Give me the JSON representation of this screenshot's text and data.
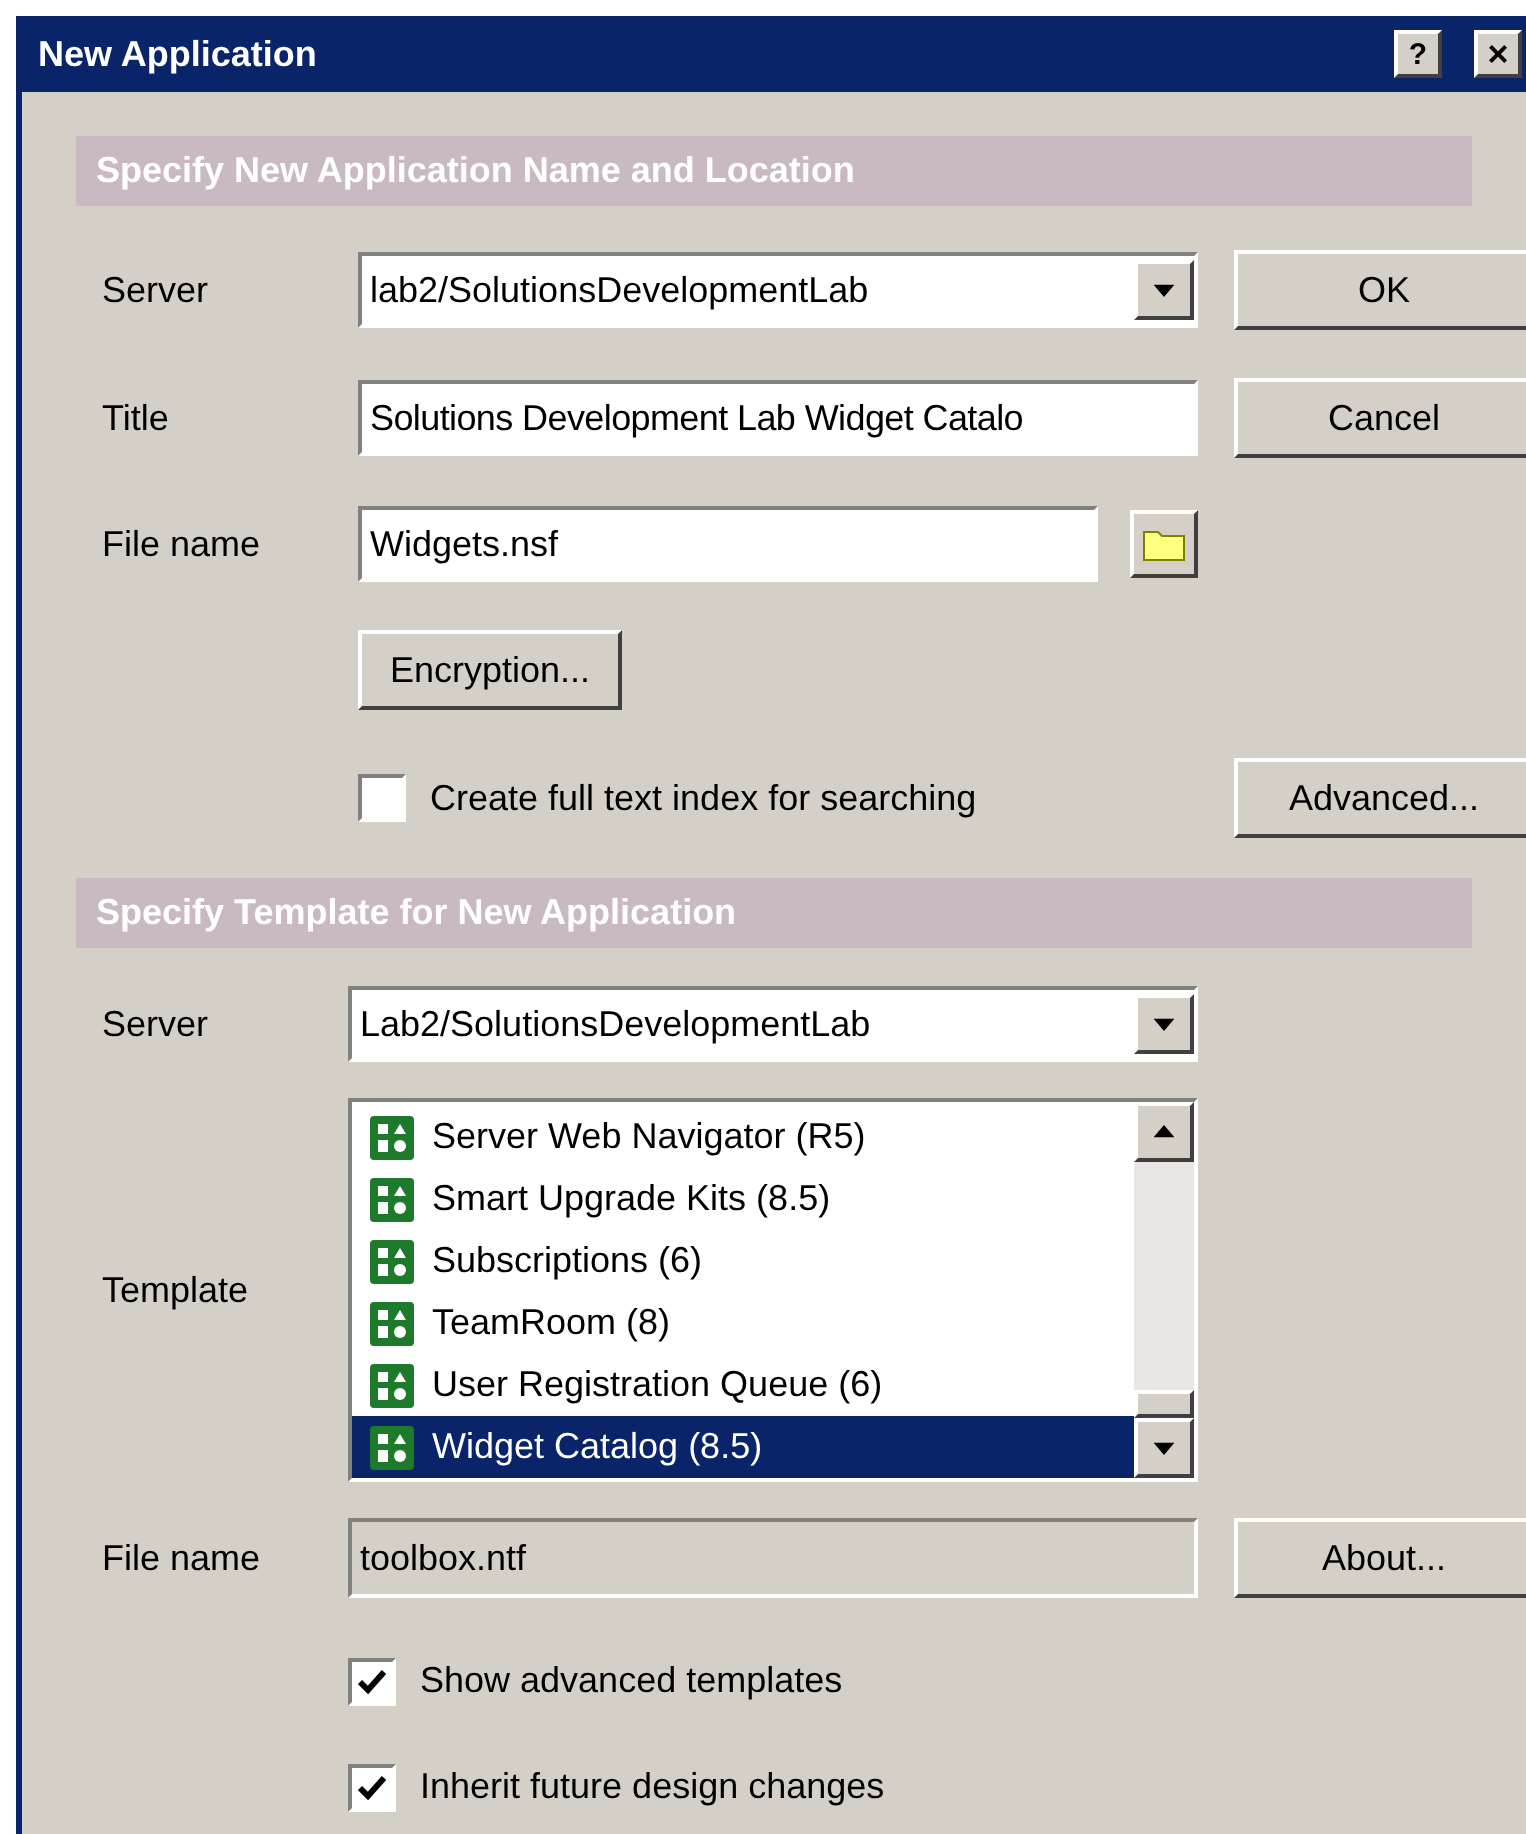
{
  "window": {
    "title": "New Application",
    "buttons": [
      "?",
      "×"
    ]
  },
  "section_1": {
    "header": "Specify New Application Name and Location",
    "server": {
      "label": "Server",
      "value": "lab2/SolutionsDevelopmentLab"
    },
    "title": {
      "label": "Title",
      "value": "Solutions Development Lab Widget Catalo"
    },
    "file_name": {
      "label": "File name",
      "value": "Widgets.nsf"
    },
    "encryption_button": "Encryption...",
    "full_text_index": {
      "label": "Create full text index for searching",
      "checked": false
    },
    "buttons": {
      "ok": "OK",
      "cancel": "Cancel",
      "advanced": "Advanced..."
    }
  },
  "section_2": {
    "header": "Specify Template for New Application",
    "server": {
      "label": "Server",
      "value": "Lab2/SolutionsDevelopmentLab"
    },
    "template_label": "Template",
    "templates": [
      {
        "label": "Server Web Navigator (R5)",
        "selected": false
      },
      {
        "label": "Smart Upgrade Kits (8.5)",
        "selected": false
      },
      {
        "label": "Subscriptions (6)",
        "selected": false
      },
      {
        "label": "TeamRoom (8)",
        "selected": false
      },
      {
        "label": "User Registration Queue (6)",
        "selected": false
      },
      {
        "label": "Widget Catalog (8.5)",
        "selected": true
      }
    ],
    "file_name": {
      "label": "File name",
      "value": "toolbox.ntf",
      "disabled": true
    },
    "about_button": "About...",
    "options": [
      {
        "label": "Show advanced templates",
        "checked": true
      },
      {
        "label": "Inherit future design changes",
        "checked": true
      }
    ]
  }
}
